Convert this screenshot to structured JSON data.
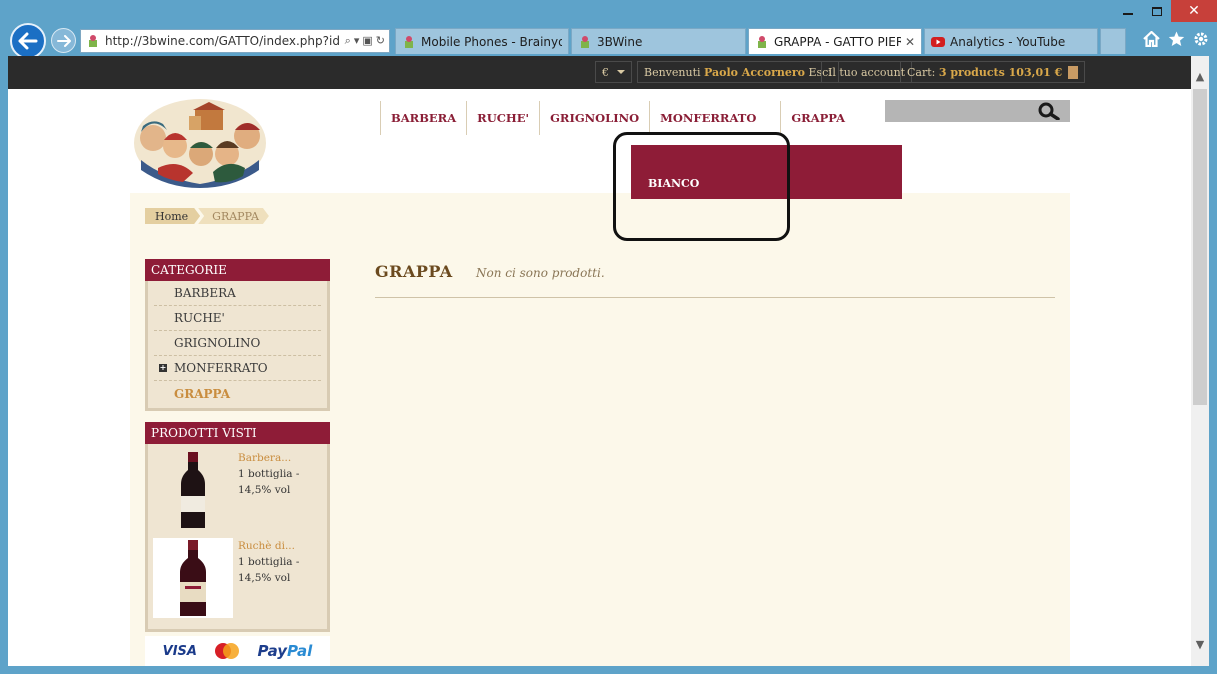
{
  "browser": {
    "url": "http://3bwine.com/GATTO/index.php?id",
    "tabs": [
      {
        "title": "Mobile Phones - Brainyde...",
        "active": false
      },
      {
        "title": "3BWine",
        "active": false
      },
      {
        "title": "GRAPPA - GATTO PIER...",
        "active": true
      },
      {
        "title": "Analytics - YouTube",
        "active": false
      }
    ]
  },
  "topbar": {
    "currency": "€",
    "welcome": "Benvenuti",
    "user_name": "Paolo Accornero",
    "logout": "Esci",
    "account": "Il tuo account",
    "cart_label": "Cart:",
    "cart_summary": "3 products 103,01 €"
  },
  "nav": {
    "items": [
      "BARBERA",
      "RUCHE'",
      "GRIGNOLINO",
      "MONFERRATO",
      "GRAPPA"
    ],
    "dropdown_item": "BIANCO"
  },
  "breadcrumb": {
    "home": "Home",
    "current": "GRAPPA"
  },
  "sidebar": {
    "categories_title": "CATEGORIE",
    "categories": [
      "BARBERA",
      "RUCHE'",
      "GRIGNOLINO",
      "MONFERRATO",
      "GRAPPA"
    ],
    "viewed_title": "PRODOTTI VISTI",
    "viewed": [
      {
        "name": "Barbera...",
        "line1": "1 bottiglia -",
        "line2": "14,5% vol"
      },
      {
        "name": "Ruchè di...",
        "line1": "1 bottiglia  -",
        "line2": "14,5% vol"
      }
    ],
    "payments": {
      "visa": "VISA",
      "mastercard": "MasterCard",
      "paypal_a": "Pay",
      "paypal_b": "Pal"
    }
  },
  "main": {
    "title": "GRAPPA",
    "empty_message": "Non ci sono prodotti."
  },
  "colors": {
    "brand": "#8e1c37",
    "accent": "#c98d3f",
    "background": "#fcf8ea"
  }
}
